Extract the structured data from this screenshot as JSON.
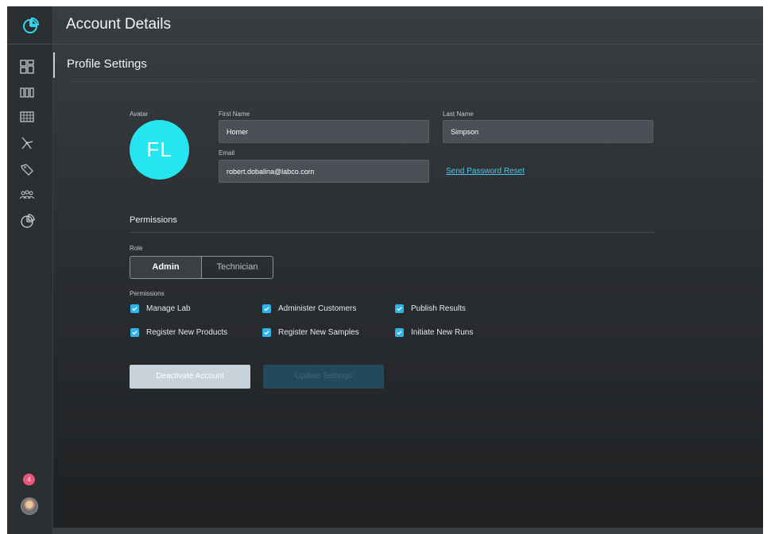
{
  "header": {
    "title": "Account Details"
  },
  "section": {
    "title": "Profile Settings"
  },
  "profile": {
    "avatar_label": "Avatar",
    "avatar_initials": "FL",
    "avatar_color": "#25e5f0",
    "first_name_label": "First Name",
    "first_name_value": "Homer",
    "last_name_label": "Last Name",
    "last_name_value": "Simpson",
    "email_label": "Email",
    "email_value": "robert.dobalina@labco.com",
    "reset_link": "Send Password Reset"
  },
  "permissions": {
    "title": "Permissions",
    "role_label": "Role",
    "roles": [
      {
        "label": "Admin",
        "active": true
      },
      {
        "label": "Technician",
        "active": false
      }
    ],
    "perms_label": "Permissions",
    "items": [
      {
        "label": "Manage Lab",
        "checked": true
      },
      {
        "label": "Administer Customers",
        "checked": true
      },
      {
        "label": "Publish Results",
        "checked": true
      },
      {
        "label": "Register New Products",
        "checked": true
      },
      {
        "label": "Register New Samples",
        "checked": true
      },
      {
        "label": "Initiate New Runs",
        "checked": true
      }
    ]
  },
  "actions": {
    "deactivate_label": "Deactivate Account",
    "update_label": "Update Settings"
  },
  "sidebar": {
    "logo_icon": "pie-logo-icon",
    "items": [
      {
        "icon": "dashboard-grid-icon"
      },
      {
        "icon": "columns-icon"
      },
      {
        "icon": "table-grid-icon"
      },
      {
        "icon": "network-icon"
      },
      {
        "icon": "tag-icon"
      },
      {
        "icon": "users-icon"
      },
      {
        "icon": "pie-chart-icon"
      }
    ],
    "notification_count": "4"
  },
  "colors": {
    "accent": "#2eb4e8",
    "notification": "#e8567a"
  }
}
